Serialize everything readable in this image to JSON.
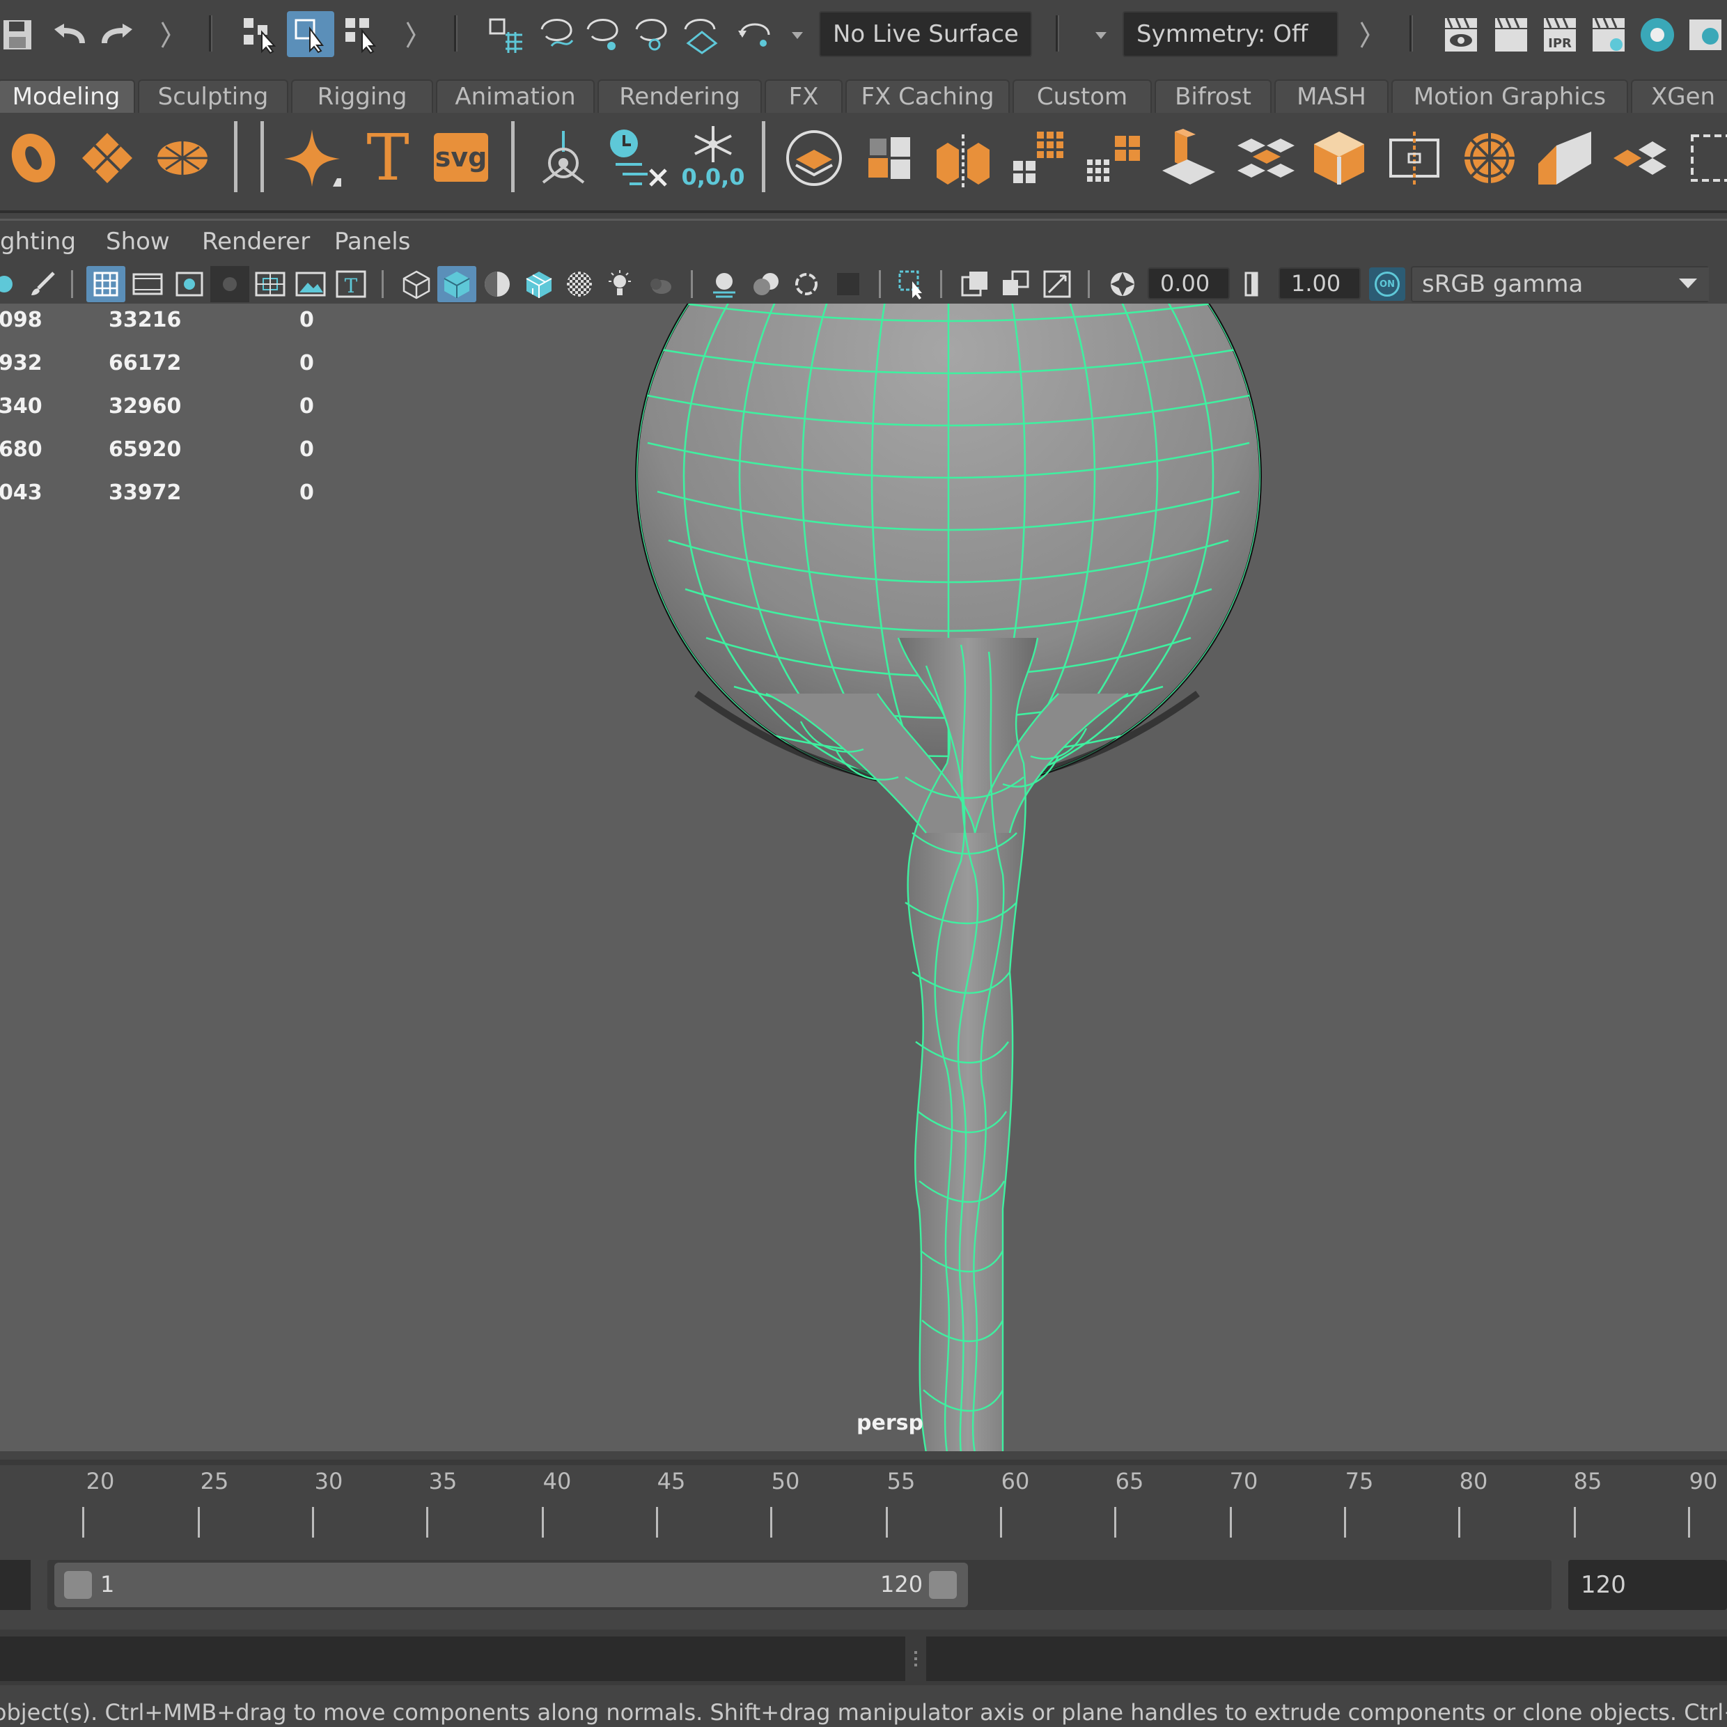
{
  "status_line": {
    "live_surface": "No Live Surface",
    "symmetry": "Symmetry: Off",
    "icons": [
      "save-icon",
      "undo-icon",
      "redo-icon",
      "select-hierarchy-icon",
      "select-object-icon",
      "select-component-icon",
      "snap-grid-icon",
      "snap-curve-icon",
      "snap-point-icon",
      "snap-projected-center-icon",
      "snap-view-plane-icon",
      "snap-live-icon",
      "render-view-icon",
      "render-frame-icon",
      "ipr-render-icon",
      "render-settings-icon",
      "hypershade-icon"
    ]
  },
  "shelf_tabs": [
    {
      "label": "Modeling",
      "active": true
    },
    {
      "label": "Sculpting"
    },
    {
      "label": "Rigging"
    },
    {
      "label": "Animation"
    },
    {
      "label": "Rendering"
    },
    {
      "label": "FX"
    },
    {
      "label": "FX Caching"
    },
    {
      "label": "Custom"
    },
    {
      "label": "Bifrost"
    },
    {
      "label": "MASH"
    },
    {
      "label": "Motion Graphics"
    },
    {
      "label": "XGen"
    }
  ],
  "shelf": {
    "text_tool_label": "T",
    "svg_tool_label": "svg",
    "freeze_label": "0,0,0",
    "accent_color": "#e8903a"
  },
  "panel_menu": [
    "ghting",
    "Show",
    "Renderer",
    "Panels"
  ],
  "panel_toolbar": {
    "exposure": "0.00",
    "gamma": "1.00",
    "color_space": "sRGB gamma",
    "on_badge": "ON"
  },
  "hud": {
    "rows": [
      {
        "a": "098",
        "b": "33216",
        "c": "0"
      },
      {
        "a": "932",
        "b": "66172",
        "c": "0"
      },
      {
        "a": "340",
        "b": "32960",
        "c": "0"
      },
      {
        "a": "680",
        "b": "65920",
        "c": "0"
      },
      {
        "a": "043",
        "b": "33972",
        "c": "0"
      }
    ],
    "camera": "persp",
    "wire_color": "#3ff0a0"
  },
  "timeline": {
    "ticks": [
      "20",
      "25",
      "30",
      "35",
      "40",
      "45",
      "50",
      "55",
      "60",
      "65",
      "70",
      "75",
      "80",
      "85",
      "90"
    ]
  },
  "range": {
    "start": "1",
    "end": "120",
    "end_field": "120"
  },
  "help_line": "e object(s). Ctrl+MMB+drag to move components along normals. Shift+drag manipulator axis or plane handles to extrude components or clone objects. Ctrl+Shift+LMB+drag to cons"
}
